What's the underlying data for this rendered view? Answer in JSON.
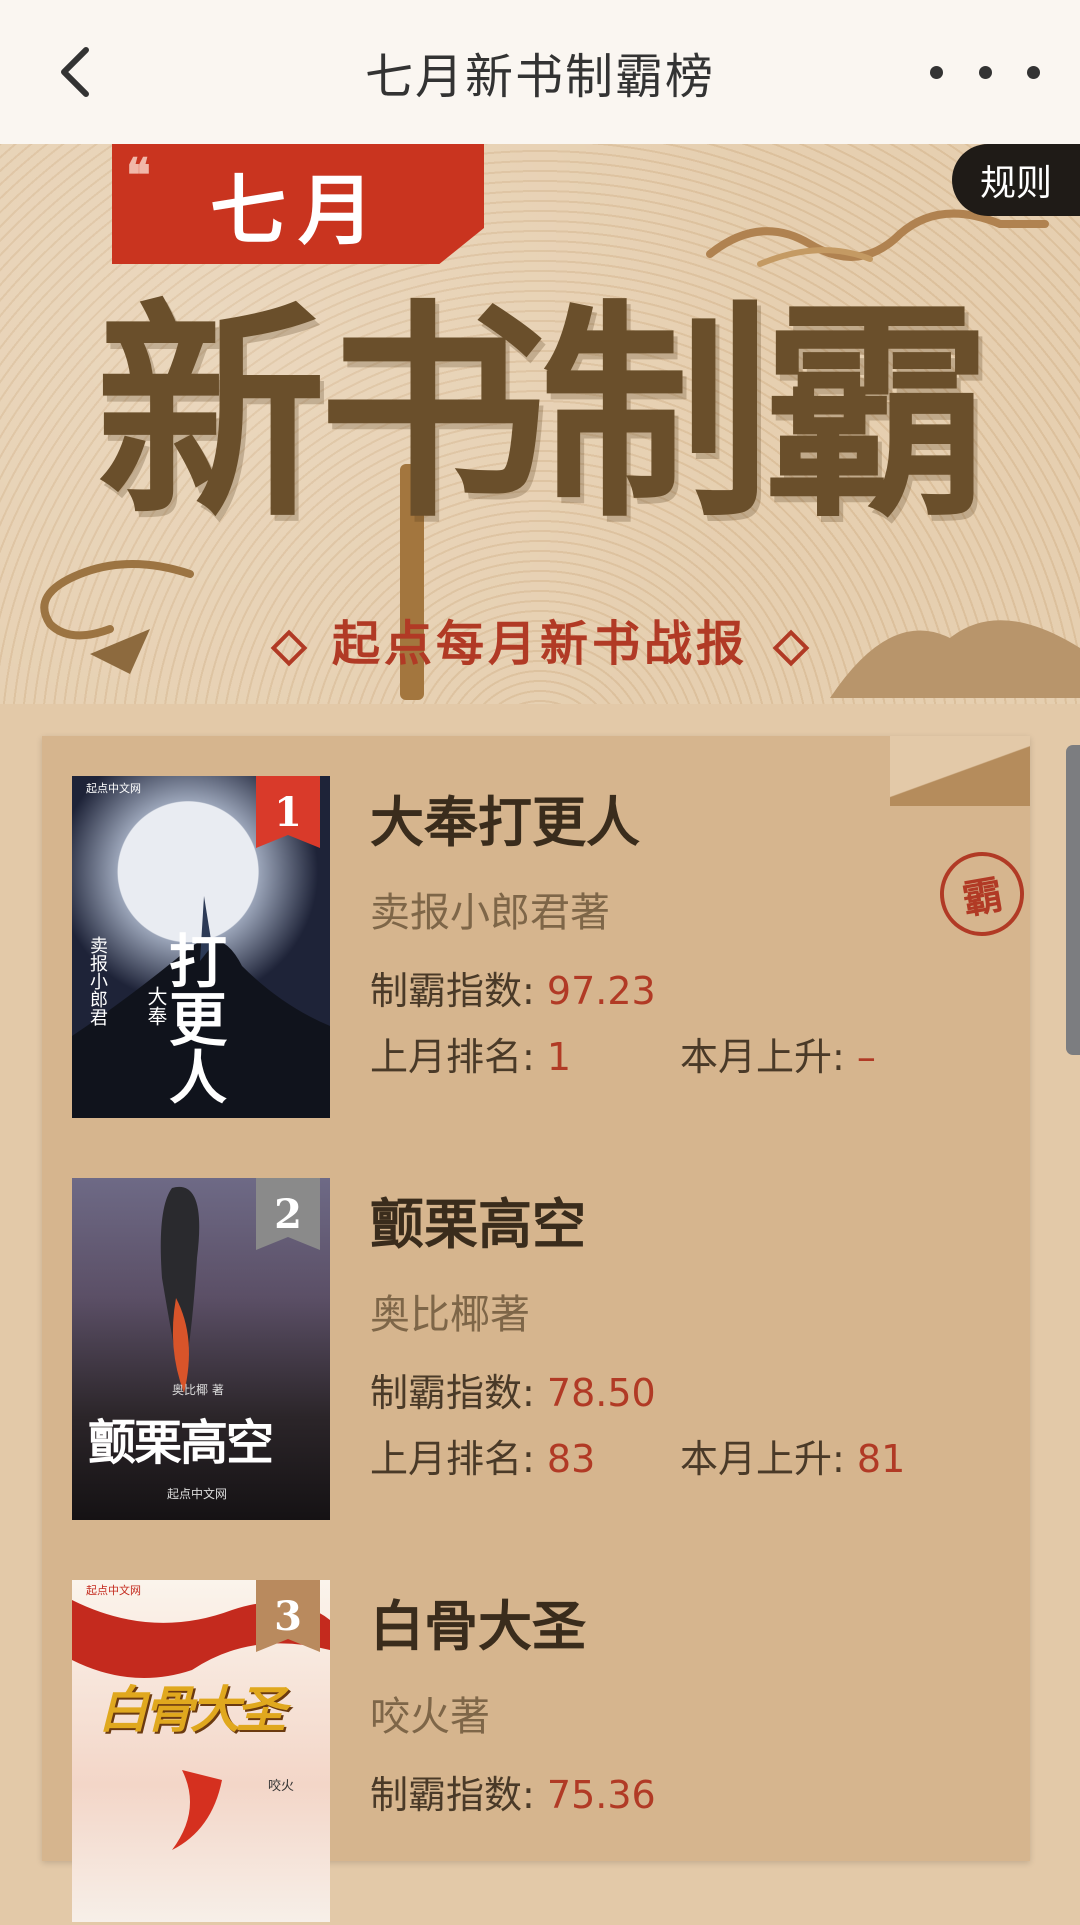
{
  "header": {
    "title": "七月新书制霸榜"
  },
  "banner": {
    "month": "七月",
    "quote_mark": "❝",
    "title": "新书制霸",
    "subtitle": "起点每月新书战报",
    "rules_label": "规则"
  },
  "labels": {
    "index": "制霸指数: ",
    "last_rank": "上月排名: ",
    "rise": "本月上升: "
  },
  "seal_char": "霸",
  "books": [
    {
      "rank": "1",
      "title": "大奉打更人",
      "author": "卖报小郎君著",
      "index": "97.23",
      "last_rank": "1",
      "rise": "–",
      "cover_text": "打更人",
      "cover_subtext": "大奉",
      "cover_author": "卖报小郎君",
      "publisher": "起点中文网",
      "badge_color": "#d93a2a",
      "cover_color": "#1e2338"
    },
    {
      "rank": "2",
      "title": "颤栗高空",
      "author": "奥比椰著",
      "index": "78.50",
      "last_rank": "83",
      "rise": "81",
      "cover_text": "颤栗高空",
      "cover_author": "奥比椰 著",
      "publisher": "起点中文网",
      "badge_color": "#8a8a8a",
      "cover_color": "#2a2428"
    },
    {
      "rank": "3",
      "title": "白骨大圣",
      "author": "咬火著",
      "index": "75.36",
      "cover_text": "白骨大圣",
      "cover_author": "咬火",
      "publisher": "起点中文网",
      "badge_color": "#b98a5e",
      "cover_color": "#f6efe6"
    }
  ]
}
